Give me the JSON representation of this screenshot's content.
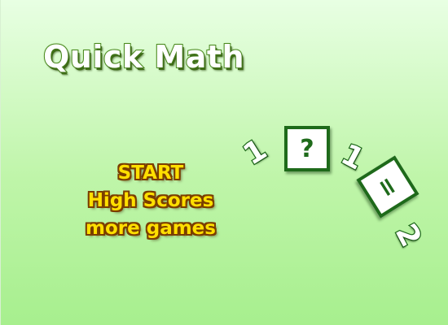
{
  "title": "Quick Math",
  "menu": {
    "start": "START",
    "high_scores": "High Scores",
    "more_games": "more games"
  },
  "equation": {
    "operand_a": "1",
    "operator": "?",
    "operand_b": "1",
    "equals": "=",
    "result": "2"
  },
  "colors": {
    "background_top": "#e8ffe3",
    "background_bottom": "#a7ef8e",
    "title_outline": "#4b8a1e",
    "menu_text": "#ffdf00",
    "menu_outline": "#7a3e00",
    "equation_green": "#1e6a1a"
  }
}
